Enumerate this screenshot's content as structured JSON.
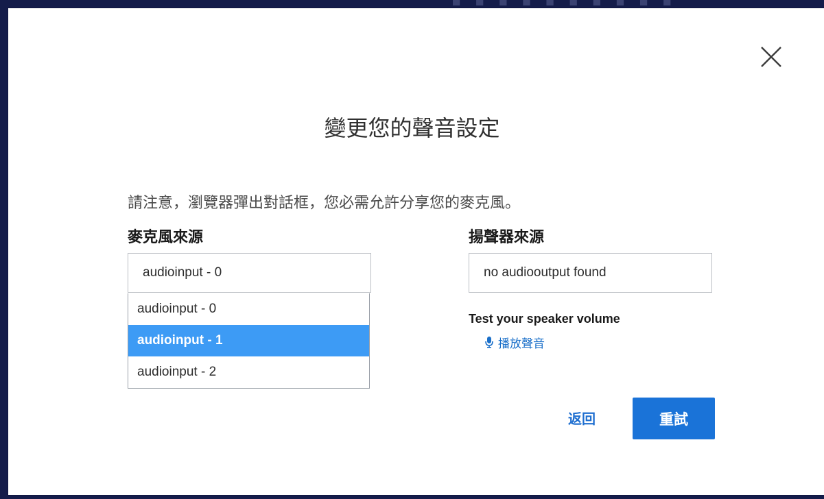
{
  "dialog": {
    "title": "變更您的聲音設定",
    "notice": "請注意，瀏覽器彈出對話框，您必需允許分享您的麥克風。"
  },
  "microphone": {
    "label": "麥克風來源",
    "selected_value": "audioinput - 0",
    "options": [
      "audioinput - 0",
      "audioinput - 1",
      "audioinput - 2"
    ],
    "highlighted_index": 1
  },
  "speaker": {
    "label": "揚聲器來源",
    "selected_value": "no audiooutput found",
    "test_label": "Test your speaker volume",
    "play_label": "播放聲音"
  },
  "actions": {
    "back_label": "返回",
    "retry_label": "重試"
  },
  "icons": {
    "close": "close-icon",
    "play": "microphone-icon"
  },
  "colors": {
    "backdrop": "#141c4a",
    "highlight": "#3d9bf5",
    "primary_button": "#1a73d8",
    "link": "#1a6fc9"
  }
}
